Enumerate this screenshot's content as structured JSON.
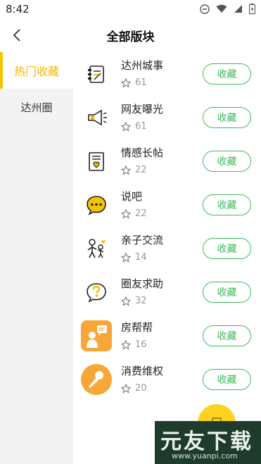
{
  "status": {
    "time": "8:42"
  },
  "header": {
    "title": "全部版块"
  },
  "sidebar": {
    "items": [
      {
        "label": "热门收藏"
      },
      {
        "label": "达州圈"
      }
    ]
  },
  "list": {
    "items": [
      {
        "name": "达州城事",
        "count": "61",
        "button": "收藏",
        "icon": "notebook-icon"
      },
      {
        "name": "网友曝光",
        "count": "61",
        "button": "收藏",
        "icon": "megaphone-icon"
      },
      {
        "name": "情感长帖",
        "count": "22",
        "button": "收藏",
        "icon": "heart-letter-icon"
      },
      {
        "name": "说吧",
        "count": "22",
        "button": "收藏",
        "icon": "chat-bubble-icon"
      },
      {
        "name": "亲子交流",
        "count": "14",
        "button": "收藏",
        "icon": "parent-child-icon"
      },
      {
        "name": "圈友求助",
        "count": "32",
        "button": "收藏",
        "icon": "question-bubble-icon"
      },
      {
        "name": "房帮帮",
        "count": "16",
        "button": "收藏",
        "icon": "house-helper-icon"
      },
      {
        "name": "消费维权",
        "count": "20",
        "button": "收藏",
        "icon": "microphone-icon"
      }
    ]
  },
  "watermark": {
    "big": "元友下载",
    "small": "www.yuanpi.com"
  },
  "colors": {
    "accent": "#f5c400",
    "green": "#3fba5c",
    "sidebar_bg": "#f3f3f3"
  }
}
